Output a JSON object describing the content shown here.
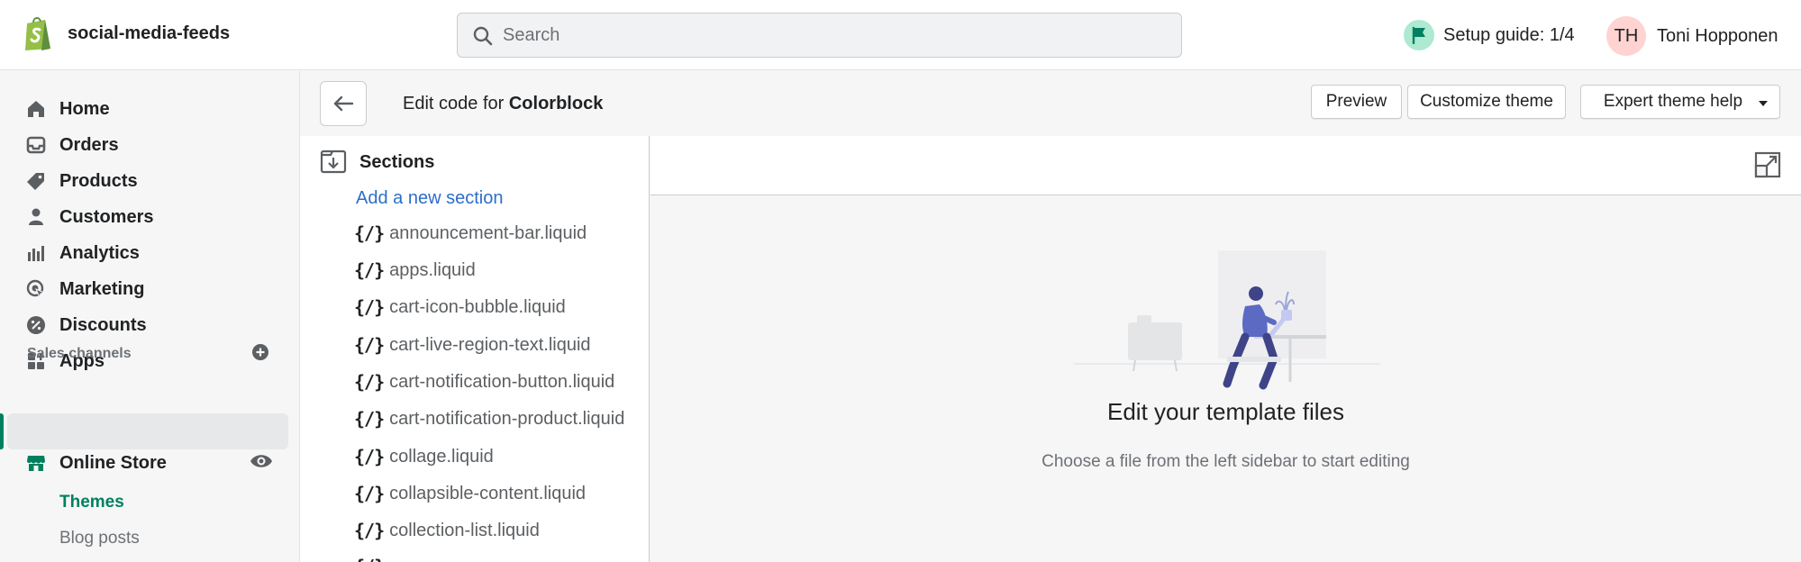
{
  "topbar": {
    "store_name": "social-media-feeds",
    "search_placeholder": "Search",
    "setup_guide": "Setup guide: 1/4",
    "user_initials": "TH",
    "user_name": "Toni Hopponen"
  },
  "nav": {
    "items": [
      {
        "label": "Home",
        "icon": "home-icon"
      },
      {
        "label": "Orders",
        "icon": "orders-icon"
      },
      {
        "label": "Products",
        "icon": "tag-icon"
      },
      {
        "label": "Customers",
        "icon": "person-icon"
      },
      {
        "label": "Analytics",
        "icon": "bar-chart-icon"
      },
      {
        "label": "Marketing",
        "icon": "target-icon"
      },
      {
        "label": "Discounts",
        "icon": "discount-icon"
      },
      {
        "label": "Apps",
        "icon": "apps-icon"
      }
    ],
    "sales_channels_label": "Sales channels",
    "online_store": "Online Store",
    "sub_items": [
      "Themes",
      "Blog posts"
    ]
  },
  "header": {
    "title_prefix": "Edit code for",
    "theme_name": "Colorblock",
    "preview": "Preview",
    "customize": "Customize theme",
    "expert_help": "Expert theme help"
  },
  "files": {
    "folder": "Sections",
    "add_link": "Add a new section",
    "brace": "{/}",
    "list": [
      "announcement-bar.liquid",
      "apps.liquid",
      "cart-icon-bubble.liquid",
      "cart-live-region-text.liquid",
      "cart-notification-button.liquid",
      "cart-notification-product.liquid",
      "collage.liquid",
      "collapsible-content.liquid",
      "collection-list.liquid"
    ]
  },
  "editor": {
    "empty_title": "Edit your template files",
    "empty_subtitle": "Choose a file from the left sidebar to start editing"
  },
  "colors": {
    "brand_green": "#008060",
    "link_blue": "#2c6ecb",
    "illustration_purple": "#5c6ac4"
  }
}
